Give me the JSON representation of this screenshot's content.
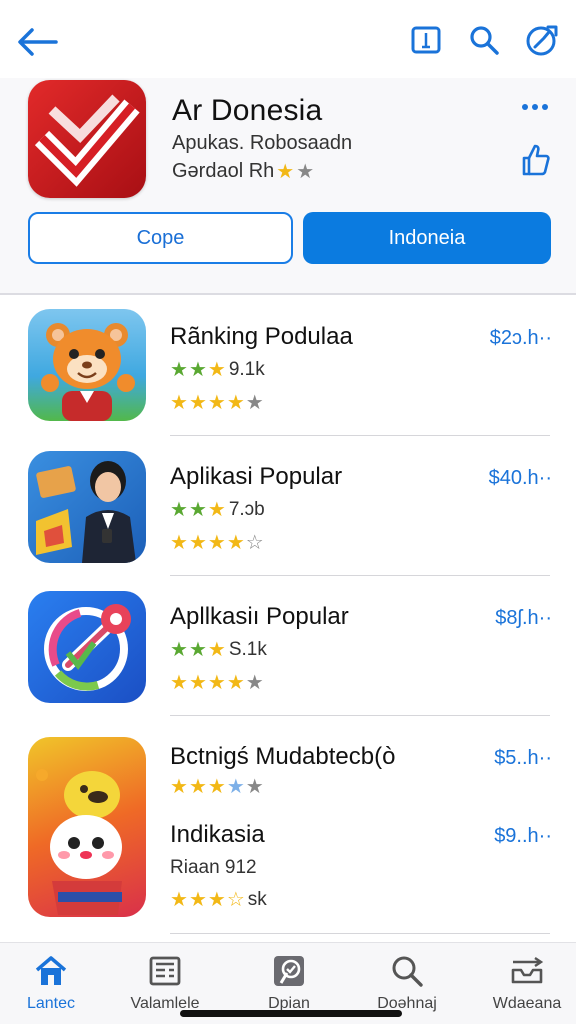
{
  "hero": {
    "title": "Ar Donesia",
    "subtitle": "Apukas. Robosaadn",
    "subtitle2": "Gərdaol Rh",
    "btn_outline": "Cope",
    "btn_fill": "Indoneia"
  },
  "apps": [
    {
      "title": "Rãnking Podulaa",
      "line1": "9.1k",
      "price": "$2ɔ.h··"
    },
    {
      "title": "Aplikasi Popular",
      "line1": "7.ɔb",
      "price": "$40.h··"
    },
    {
      "title": "Apllkasiı Popular",
      "line1": "S.1k",
      "price": "$8ʃ.h··"
    },
    {
      "title": "Bctnigś Mudabtecb(ò",
      "title2": "Indikasia",
      "line2": "Riaan 912",
      "line3": "sk",
      "price": "$5..h··",
      "price2": "$9..h··"
    }
  ],
  "tabs": [
    {
      "label": "Lantec",
      "icon": "home-icon"
    },
    {
      "label": "Valamlele",
      "icon": "newspaper-icon"
    },
    {
      "label": "Dpian",
      "icon": "badge-icon"
    },
    {
      "label": "Doəhnaj",
      "icon": "search-icon"
    },
    {
      "label": "Wdaeana",
      "icon": "tray-icon"
    }
  ],
  "colors": {
    "accent": "#1a73d9",
    "button_fill": "#0b7be0"
  }
}
